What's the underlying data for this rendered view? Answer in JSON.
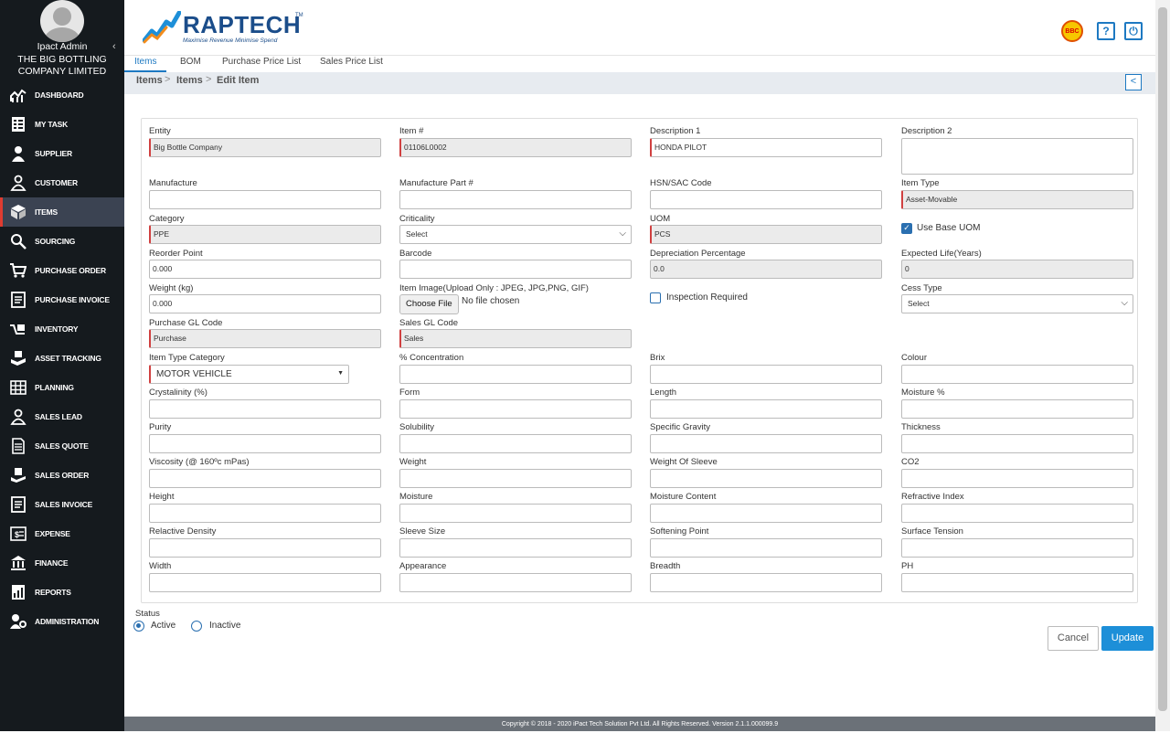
{
  "sidebar": {
    "user_name": "Ipact Admin",
    "company_line1": "THE BIG BOTTLING",
    "company_line2": "COMPANY LIMITED",
    "collapse_icon": "chevron-left-icon",
    "items": [
      {
        "label": "DASHBOARD",
        "icon": "dashboard-icon"
      },
      {
        "label": "MY TASK",
        "icon": "task-icon"
      },
      {
        "label": "SUPPLIER",
        "icon": "supplier-icon"
      },
      {
        "label": "CUSTOMER",
        "icon": "customer-icon"
      },
      {
        "label": "ITEMS",
        "icon": "items-icon"
      },
      {
        "label": "SOURCING",
        "icon": "sourcing-icon"
      },
      {
        "label": "PURCHASE ORDER",
        "icon": "cart-icon"
      },
      {
        "label": "PURCHASE INVOICE",
        "icon": "invoice-icon"
      },
      {
        "label": "INVENTORY",
        "icon": "inventory-icon"
      },
      {
        "label": "ASSET TRACKING",
        "icon": "asset-icon"
      },
      {
        "label": "PLANNING",
        "icon": "grid-icon"
      },
      {
        "label": "SALES LEAD",
        "icon": "lead-icon"
      },
      {
        "label": "SALES QUOTE",
        "icon": "quote-icon"
      },
      {
        "label": "SALES ORDER",
        "icon": "order-icon"
      },
      {
        "label": "SALES INVOICE",
        "icon": "invoice-icon"
      },
      {
        "label": "EXPENSE",
        "icon": "expense-icon"
      },
      {
        "label": "FINANCE",
        "icon": "bank-icon"
      },
      {
        "label": "REPORTS",
        "icon": "reports-icon"
      },
      {
        "label": "ADMINISTRATION",
        "icon": "admin-icon"
      }
    ],
    "active_index": 4
  },
  "header": {
    "logo_text": "RAPTECH",
    "logo_tm": "TM",
    "logo_tagline": "Maximise Revenue Minimise Spend",
    "badge_text": "BBC",
    "help_icon": "?",
    "power_icon": "⏻"
  },
  "tabs": [
    "Items",
    "BOM",
    "Purchase Price List",
    "Sales Price List"
  ],
  "breadcrumb": [
    "Items",
    "Items",
    "Edit Item"
  ],
  "breadcrumb_sep": ">",
  "form": {
    "entity": {
      "label": "Entity",
      "value": "Big Bottle Company"
    },
    "item_no": {
      "label": "Item #",
      "value": "01106L0002"
    },
    "desc1": {
      "label": "Description 1",
      "value": "HONDA PILOT"
    },
    "desc2": {
      "label": "Description 2",
      "value": ""
    },
    "manufacture": {
      "label": "Manufacture",
      "value": ""
    },
    "mfr_part": {
      "label": "Manufacture Part #",
      "value": ""
    },
    "hsn": {
      "label": "HSN/SAC Code",
      "value": ""
    },
    "item_type": {
      "label": "Item Type",
      "value": "Asset-Movable"
    },
    "category": {
      "label": "Category",
      "value": "PPE"
    },
    "criticality": {
      "label": "Criticality",
      "value": "Select"
    },
    "uom": {
      "label": "UOM",
      "value": "PCS"
    },
    "use_base_uom": {
      "label": "Use Base UOM",
      "checked": true
    },
    "reorder": {
      "label": "Reorder Point",
      "value": "0.000"
    },
    "barcode": {
      "label": "Barcode",
      "value": ""
    },
    "depreciation": {
      "label": "Depreciation Percentage",
      "value": "0.0"
    },
    "expected_life": {
      "label": "Expected Life(Years)",
      "value": "0"
    },
    "weight_kg": {
      "label": "Weight (kg)",
      "value": "0.000"
    },
    "item_image": {
      "label": "Item Image",
      "hint": "(Upload Only : JPEG, JPG,PNG, GIF)",
      "button": "Choose File",
      "status": "No file chosen"
    },
    "inspection": {
      "label": "Inspection Required",
      "checked": false
    },
    "cess_type": {
      "label": "Cess Type",
      "value": "Select"
    },
    "purchase_gl": {
      "label": "Purchase GL Code",
      "value": "Purchase"
    },
    "sales_gl": {
      "label": "Sales GL Code",
      "value": "Sales"
    },
    "item_type_category": {
      "label": "Item Type Category",
      "value": "MOTOR VEHICLE"
    },
    "grid": [
      [
        "% Concentration",
        "Brix",
        "Colour"
      ],
      [
        "Crystalinity (%)",
        "Form",
        "Length",
        "Moisture %"
      ],
      [
        "Purity",
        "Solubility",
        "Specific Gravity",
        "Thickness"
      ],
      [
        "Viscosity (@ 160ºc mPas)",
        "Weight",
        "Weight Of Sleeve",
        "CO2"
      ],
      [
        "Height",
        "Moisture",
        "Moisture Content",
        "Refractive Index"
      ],
      [
        "Relactive Density",
        "Sleeve Size",
        "Softening Point",
        "Surface Tension"
      ],
      [
        "Width",
        "Appearance",
        "Breadth",
        "PH"
      ]
    ]
  },
  "status": {
    "label": "Status",
    "options": [
      "Active",
      "Inactive"
    ],
    "selected": "Active"
  },
  "buttons": {
    "cancel": "Cancel",
    "update": "Update"
  },
  "footer": "Copyright © 2018 - 2020 iPact Tech Solution Pvt Ltd. All Rights Reserved. Version 2.1.1.000099.9"
}
